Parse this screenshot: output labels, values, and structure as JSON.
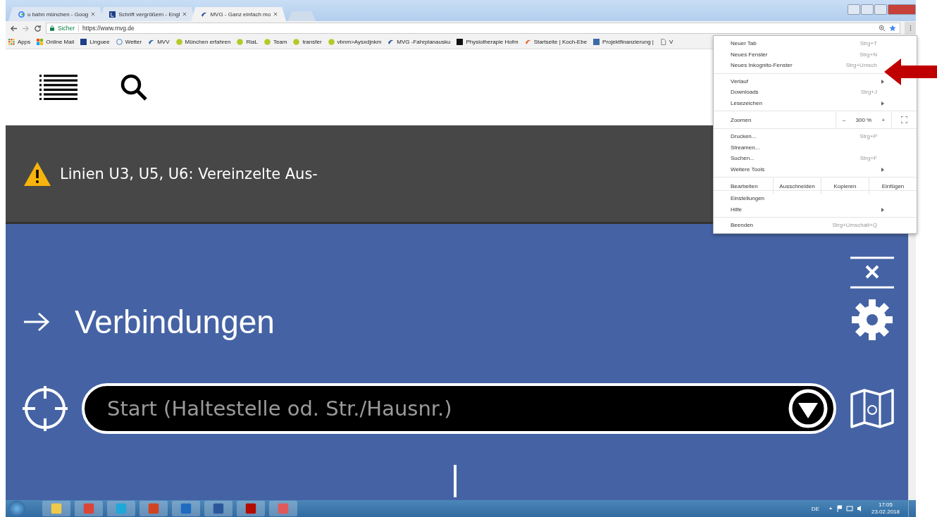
{
  "tabs": [
    {
      "title": "u bahn münchen - Goog",
      "kind": "google",
      "selected": false
    },
    {
      "title": "Schrift vergrößern - Engl",
      "kind": "linguee",
      "selected": false
    },
    {
      "title": "MVG - Ganz einfach mo",
      "kind": "mvg",
      "selected": true
    }
  ],
  "toolbar": {
    "secure_label": "Sicher",
    "url": "https://www.mvg.de"
  },
  "bookmarks": [
    {
      "label": "Apps",
      "kind": "apps"
    },
    {
      "label": "Online Mail",
      "kind": "windows"
    },
    {
      "label": "Linguee",
      "kind": "linguee"
    },
    {
      "label": "Wetter",
      "kind": "globe"
    },
    {
      "label": "MVV",
      "kind": "mvv"
    },
    {
      "label": "München erfahren",
      "kind": "leaf"
    },
    {
      "label": "RiaL",
      "kind": "leaf"
    },
    {
      "label": "Team",
      "kind": "leaf"
    },
    {
      "label": "transfer",
      "kind": "leaf"
    },
    {
      "label": "vbnm>Aysxdjnkm",
      "kind": "leaf"
    },
    {
      "label": "MVG -Fahrplanausku",
      "kind": "mvg"
    },
    {
      "label": "Physiotherapie Hofm",
      "kind": "letter-b"
    },
    {
      "label": "Startseite | Koch-Ebe",
      "kind": "flame"
    },
    {
      "label": "Projektfinanzierung |",
      "kind": "image"
    },
    {
      "label": "V",
      "kind": "page"
    }
  ],
  "site": {
    "alert": "Linien U3, U5, U6: Vereinzelte Aus-",
    "heading": "Verbindungen",
    "start_field": {
      "placeholder": "Start (Haltestelle od. Str./Hausnr.)"
    }
  },
  "menu": {
    "groups": [
      [
        {
          "kind": "item",
          "label": "Neuer Tab",
          "shortcut": "Strg+T",
          "submenu": false
        },
        {
          "kind": "item",
          "label": "Neues Fenster",
          "shortcut": "Strg+N",
          "submenu": false
        },
        {
          "kind": "item",
          "label": "Neues Inkognito-Fenster",
          "shortcut": "Strg+Umsch",
          "submenu": false
        }
      ],
      [
        {
          "kind": "item",
          "label": "Verlauf",
          "submenu": true
        },
        {
          "kind": "item",
          "label": "Downloads",
          "shortcut": "Strg+J",
          "submenu": false
        },
        {
          "kind": "item",
          "label": "Lesezeichen",
          "submenu": true
        }
      ],
      [
        {
          "kind": "zoom",
          "label": "Zoomen",
          "minus": "–",
          "value": "300 %",
          "plus": "+"
        }
      ],
      [
        {
          "kind": "item",
          "label": "Drucken...",
          "shortcut": "Strg+P",
          "submenu": false
        },
        {
          "kind": "item",
          "label": "Streamen...",
          "submenu": false
        },
        {
          "kind": "item",
          "label": "Suchen...",
          "shortcut": "Strg+F",
          "submenu": false
        },
        {
          "kind": "item",
          "label": "Weitere Tools",
          "submenu": true
        }
      ],
      [
        {
          "kind": "edit",
          "label": "Bearbeiten",
          "actions": [
            "Ausschneiden",
            "Kopieren",
            "Einfügen"
          ]
        }
      ],
      [
        {
          "kind": "item",
          "label": "Einstellungen",
          "submenu": false
        },
        {
          "kind": "item",
          "label": "Hilfe",
          "submenu": true
        }
      ],
      [
        {
          "kind": "item",
          "label": "Beenden",
          "shortcut": "Strg+Umschalt+Q",
          "submenu": false
        }
      ]
    ]
  },
  "taskbar": {
    "apps": [
      {
        "kind": "explorer"
      },
      {
        "kind": "chrome"
      },
      {
        "kind": "remote"
      },
      {
        "kind": "powerpoint"
      },
      {
        "kind": "outlook"
      },
      {
        "kind": "word"
      },
      {
        "kind": "acrobat"
      },
      {
        "kind": "snipping"
      }
    ],
    "language": "DE",
    "time": "17:05",
    "date": "23.02.2018"
  }
}
